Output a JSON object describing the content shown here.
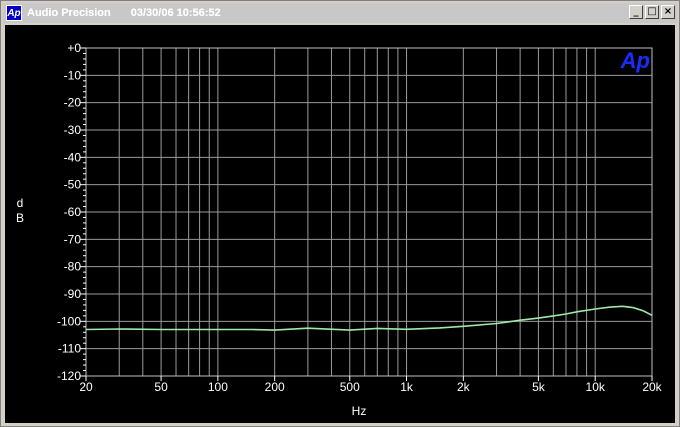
{
  "window": {
    "app_title": "Audio Precision",
    "timestamp": "03/30/06 10:56:52",
    "icon_label": "Ap",
    "minimize_glyph": "_",
    "maximize_glyph": "□",
    "close_glyph": "×"
  },
  "plot": {
    "logo": "Ap",
    "background": "#000000",
    "grid_color": "#9a9a9a",
    "trace_color": "#9fe8a8"
  },
  "chart_data": {
    "type": "line",
    "title": "",
    "xlabel": "Hz",
    "ylabel": "d B",
    "x_scale": "log",
    "xlim": [
      20,
      20000
    ],
    "ylim": [
      -120,
      0
    ],
    "x_ticks": [
      {
        "value": 20,
        "label": "20"
      },
      {
        "value": 50,
        "label": "50"
      },
      {
        "value": 100,
        "label": "100"
      },
      {
        "value": 200,
        "label": "200"
      },
      {
        "value": 500,
        "label": "500"
      },
      {
        "value": 1000,
        "label": "1k"
      },
      {
        "value": 2000,
        "label": "2k"
      },
      {
        "value": 5000,
        "label": "5k"
      },
      {
        "value": 10000,
        "label": "10k"
      },
      {
        "value": 20000,
        "label": "20k"
      }
    ],
    "y_ticks": [
      {
        "value": 0,
        "label": "+0"
      },
      {
        "value": -10,
        "label": "-10"
      },
      {
        "value": -20,
        "label": "-20"
      },
      {
        "value": -30,
        "label": "-30"
      },
      {
        "value": -40,
        "label": "-40"
      },
      {
        "value": -50,
        "label": "-50"
      },
      {
        "value": -60,
        "label": "-60"
      },
      {
        "value": -70,
        "label": "-70"
      },
      {
        "value": -80,
        "label": "-80"
      },
      {
        "value": -90,
        "label": "-90"
      },
      {
        "value": -100,
        "label": "-100"
      },
      {
        "value": -110,
        "label": "-110"
      },
      {
        "value": -120,
        "label": "-120"
      }
    ],
    "grid": true,
    "series": [
      {
        "x": [
          20,
          30,
          50,
          70,
          100,
          150,
          200,
          300,
          500,
          700,
          1000,
          1500,
          2000,
          3000,
          4000,
          5000,
          6000,
          7000,
          8000,
          10000,
          12000,
          14000,
          16000,
          18000,
          20000
        ],
        "y": [
          -103,
          -102.8,
          -103,
          -103,
          -103,
          -103,
          -103.2,
          -102.5,
          -103.2,
          -102.6,
          -102.9,
          -102.4,
          -101.8,
          -100.8,
          -99.6,
          -98.8,
          -98,
          -97.3,
          -96.5,
          -95.5,
          -94.8,
          -94.5,
          -95,
          -96.2,
          -97.8
        ]
      }
    ]
  }
}
